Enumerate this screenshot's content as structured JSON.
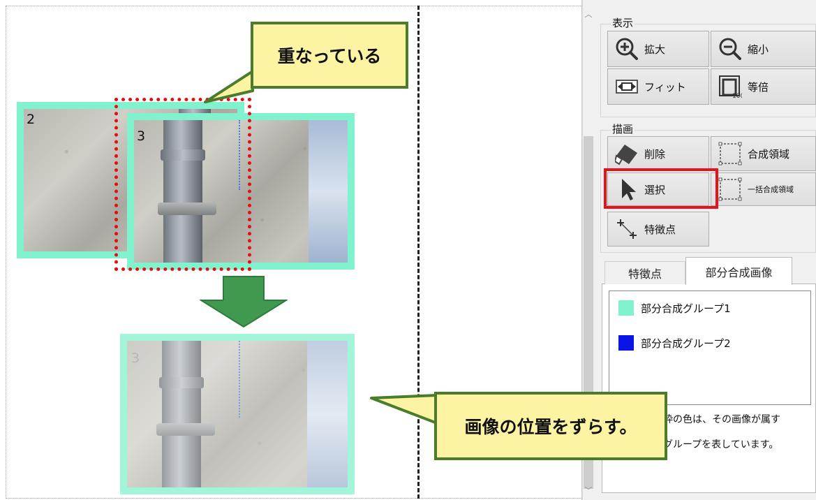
{
  "canvas": {
    "image_labels": {
      "img2": "2",
      "img3": "3",
      "img3_moved": "3"
    },
    "callout_overlap": "重なっている",
    "callout_shift": "画像の位置をずらす。",
    "frame_color": "#80f2cd"
  },
  "panel": {
    "display_group": {
      "title": "表示",
      "zoom_in": "拡大",
      "zoom_out": "縮小",
      "fit": "フィット",
      "actual_size": "等倍"
    },
    "draw_group": {
      "title": "描画",
      "delete": "削除",
      "composite_region": "合成領域",
      "select": "選択",
      "batch_composite_region": "一括合成領域",
      "feature_point": "特徴点"
    },
    "tabs": [
      {
        "label": "特徴点"
      },
      {
        "label": "部分合成画像"
      }
    ],
    "legend": [
      {
        "label": "部分合成グループ1",
        "color": "#80f2cd"
      },
      {
        "label": "部分合成グループ2",
        "color": "#0a14e6"
      }
    ],
    "description_line1": "枠の色は、その画像が属す",
    "description_line2": "グループを表しています。"
  }
}
